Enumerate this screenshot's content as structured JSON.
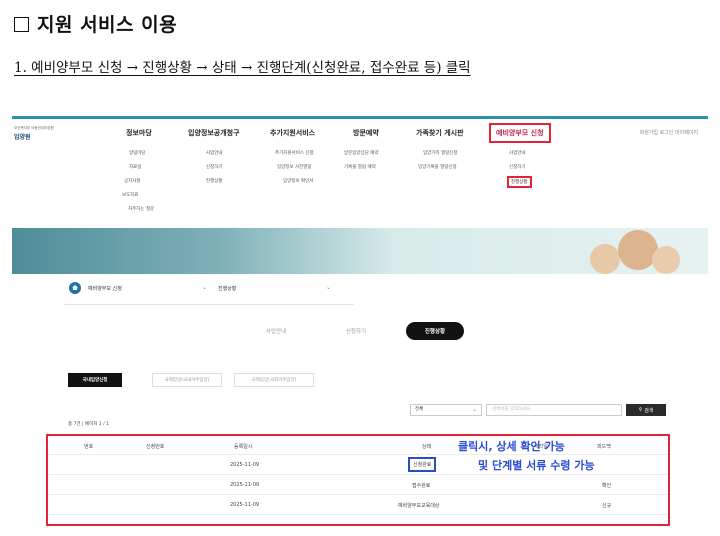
{
  "doc": {
    "title": "지원 서비스 이용",
    "step": "1. 예비양부모 신청 → 진행상황 → 상태 → 진행단계(신청완료, 접수완료 등) 클릭"
  },
  "site": {
    "logo_small": "보건복지부 아동권리보장원",
    "logo_name": "입양원",
    "util": "회원가입 로그인 마이페이지"
  },
  "gnb": [
    "정보마당",
    "입양정보공개청구",
    "추가지원서비스",
    "방문예약",
    "가족찾기 게시판",
    "예비양부모 신청"
  ],
  "submenus": {
    "col1": [
      "알림마당",
      "자료실",
      "공지사항",
      "보도자료",
      "자주하는 질문"
    ],
    "col2": [
      "사업안내",
      "신청하기",
      "진행상황"
    ],
    "col3": [
      "추가지원서비스 신청",
      "입양정보 사전열람",
      "입양정보 확인서"
    ],
    "col4": [
      "방문입양상담 예약",
      "기록물 열람 예약"
    ],
    "col5": [
      "입양가족 열람신청",
      "입양기록물 열람신청"
    ],
    "col6": [
      "사업안내",
      "신청하기",
      "진행상황"
    ]
  },
  "breadcrumb": {
    "first": "예비양부모 신청",
    "second": "진행상황"
  },
  "tabs": [
    "사업안내",
    "신청하기",
    "진행상황"
  ],
  "subtabs": [
    "국내입양신청",
    "국제입양(국내거주입양)",
    "국제입양(국외거주입양)"
  ],
  "search": {
    "select_value": "전체",
    "placeholder": "검색어를 입력하세요",
    "button": "검색"
  },
  "count_text": "총 7건 | 페이지 1 / 1",
  "table": {
    "headers": [
      "번호",
      "신청번호",
      "등록일시",
      "상태",
      "처리일",
      "피드백"
    ],
    "rows": [
      {
        "date": "2025-11-09",
        "status": "신청완료",
        "feedback": ""
      },
      {
        "date": "2025-11-09",
        "status": "접수완료",
        "feedback": "확인"
      },
      {
        "date": "2025-11-09",
        "status": "예비양부모교육대상",
        "feedback": "신규"
      }
    ]
  },
  "notes": [
    "클릭시, 상세 확인 가능",
    "및 단계별 서류 수령 가능"
  ],
  "colors": {
    "highlight_red": "#e2233a",
    "highlight_blue": "#2b4bc7",
    "note_text": "#2a4bd6",
    "brand": "#1e73a8"
  }
}
